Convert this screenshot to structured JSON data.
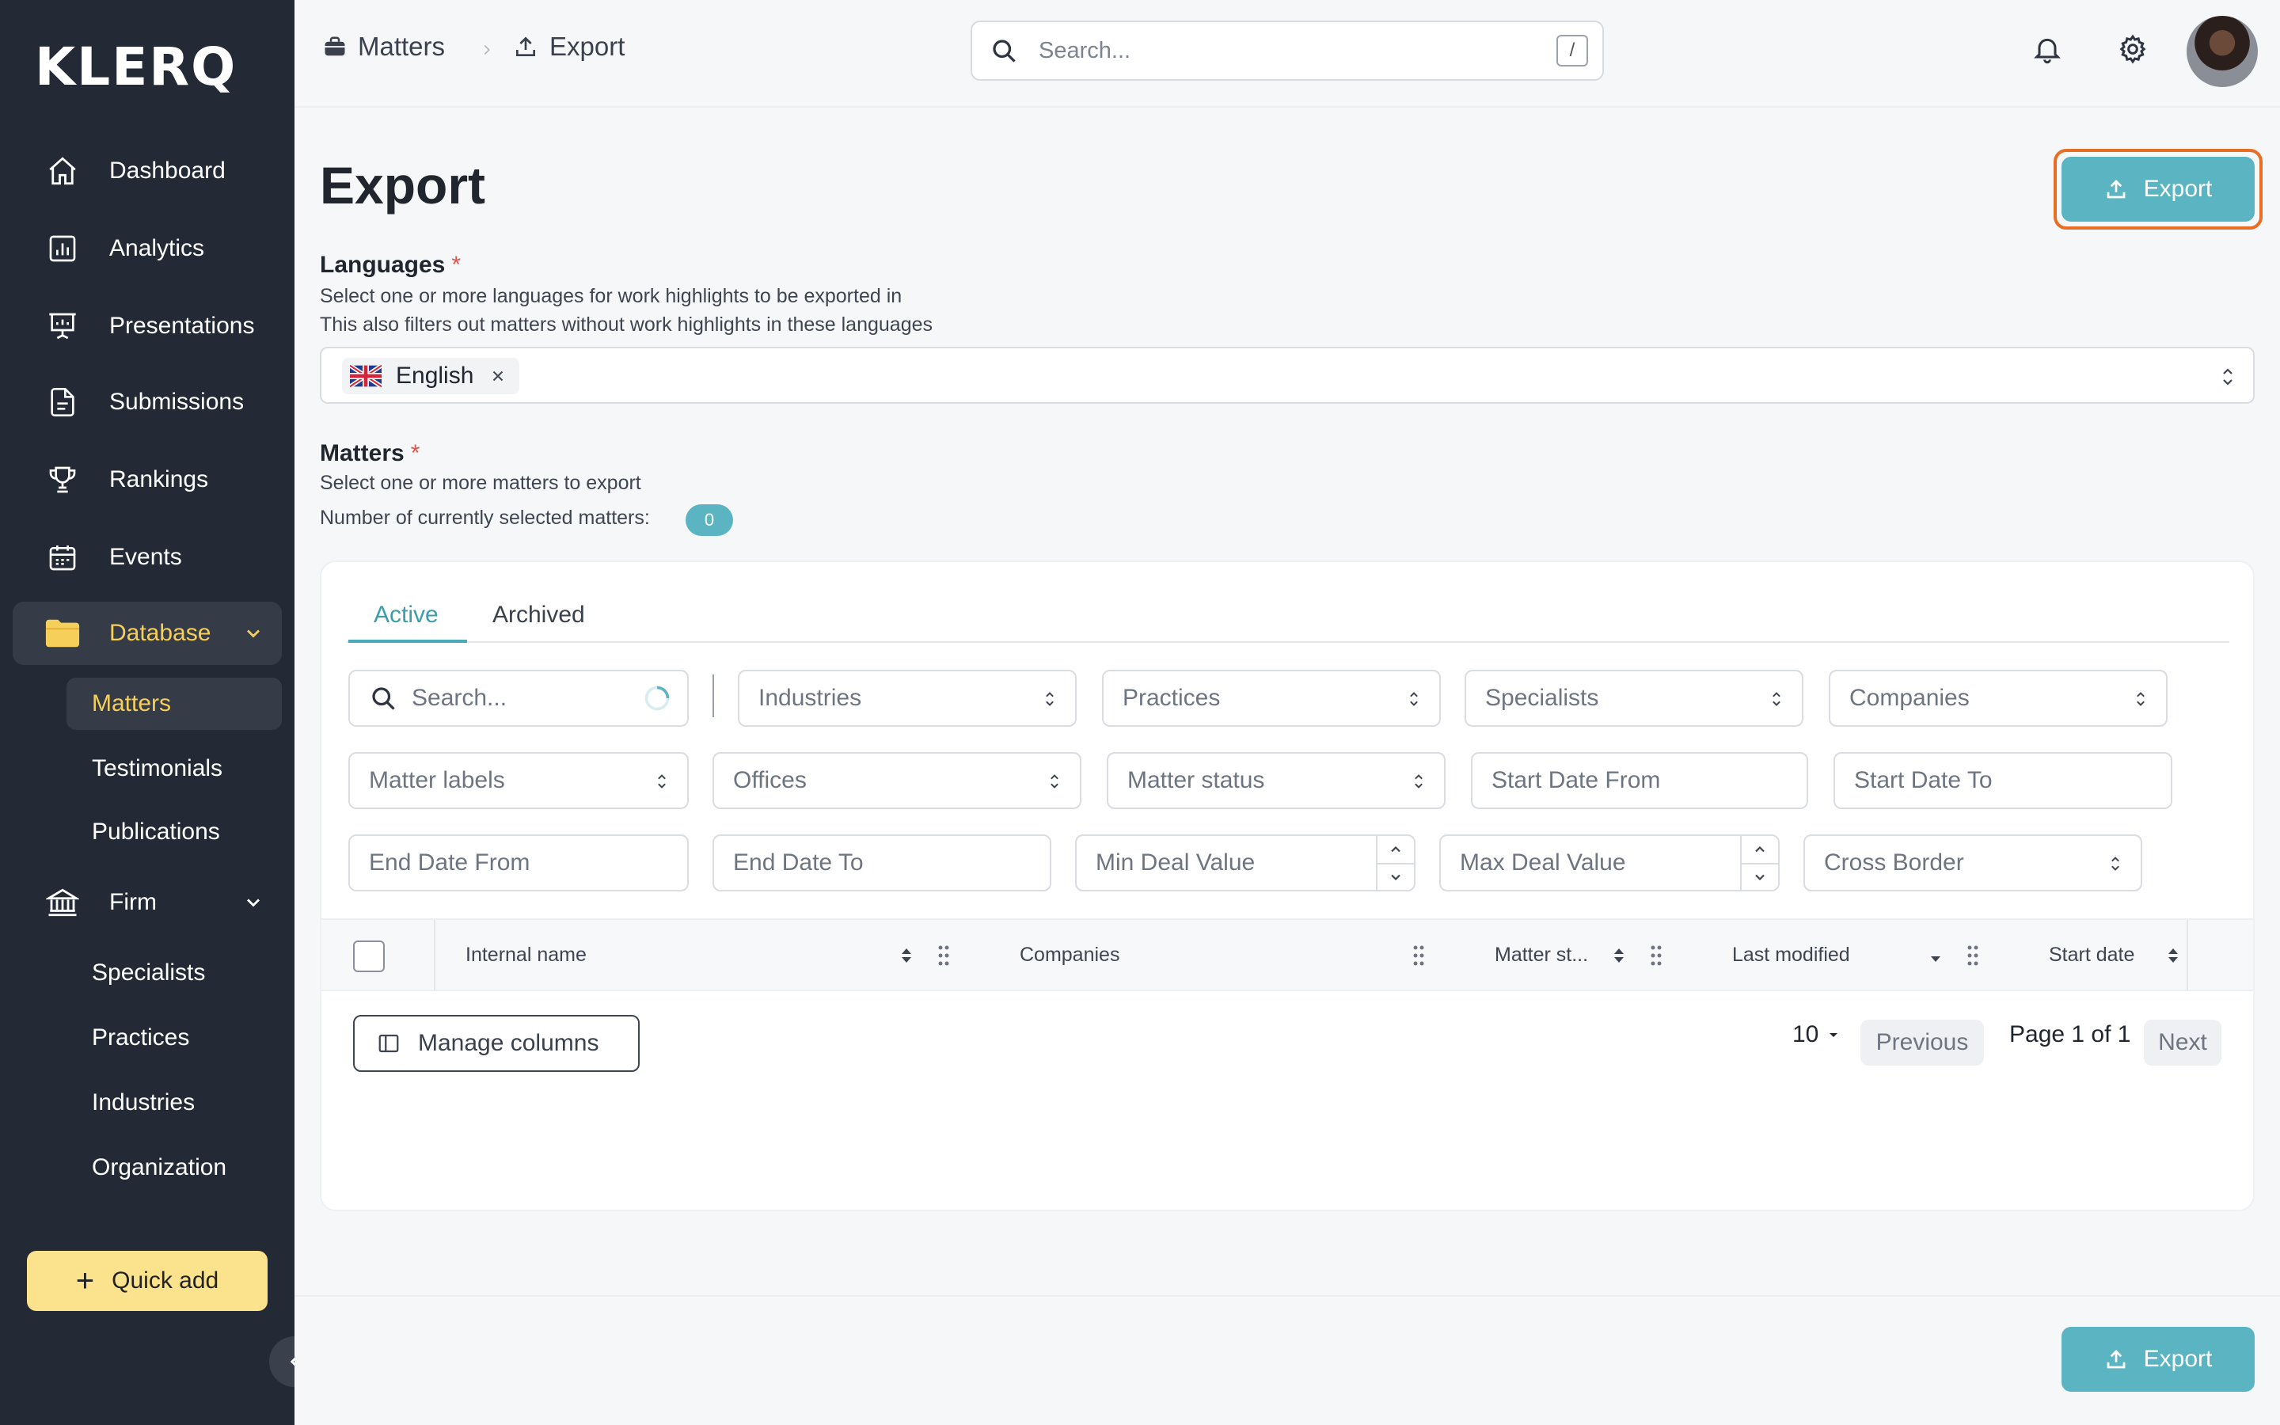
{
  "app": {
    "logo": "KLERQ"
  },
  "sidebar": {
    "items": [
      {
        "label": "Dashboard",
        "icon": "home-icon"
      },
      {
        "label": "Analytics",
        "icon": "analytics-icon"
      },
      {
        "label": "Presentations",
        "icon": "presentation-icon"
      },
      {
        "label": "Submissions",
        "icon": "document-icon"
      },
      {
        "label": "Rankings",
        "icon": "trophy-icon"
      },
      {
        "label": "Events",
        "icon": "calendar-icon"
      },
      {
        "label": "Database",
        "icon": "folder-icon"
      }
    ],
    "database_sub": [
      "Matters",
      "Testimonials",
      "Publications"
    ],
    "firm": {
      "label": "Firm",
      "icon": "bank-icon"
    },
    "firm_sub": [
      "Specialists",
      "Practices",
      "Industries",
      "Organization"
    ],
    "quick_add": "Quick add",
    "active_color": "#f6cf5a"
  },
  "topbar": {
    "breadcrumb": [
      {
        "label": "Matters",
        "icon": "briefcase-icon"
      },
      {
        "label": "Export",
        "icon": "upload-icon"
      }
    ],
    "search_placeholder": "Search...",
    "shortcut": "/"
  },
  "page": {
    "title": "Export",
    "export_button": "Export",
    "accent": "#5ab4c1",
    "focus_color": "#ea6d24"
  },
  "languages": {
    "label": "Languages",
    "required": "*",
    "help1": "Select one or more languages for work highlights to be exported in",
    "help2": "This also filters out matters without work highlights in these languages",
    "selected": "English"
  },
  "matters": {
    "label": "Matters",
    "required": "*",
    "help1": "Select one or more matters to export",
    "count_label": "Number of currently selected matters:",
    "count": "0"
  },
  "tabs": [
    "Active",
    "Archived"
  ],
  "filters": {
    "search": "Search...",
    "row1": [
      "Industries",
      "Practices",
      "Specialists",
      "Companies"
    ],
    "row2": [
      "Matter labels",
      "Offices",
      "Matter status",
      "Start Date From",
      "Start Date To"
    ],
    "row3": [
      "End Date From",
      "End Date To",
      "Min Deal Value",
      "Max Deal Value",
      "Cross Border"
    ]
  },
  "table": {
    "columns": [
      "Internal name",
      "Companies",
      "Matter st...",
      "Last modified",
      "Start date"
    ]
  },
  "pagination": {
    "manage_columns": "Manage columns",
    "page_size": "10",
    "previous": "Previous",
    "page_info": "Page 1 of 1",
    "next": "Next"
  }
}
